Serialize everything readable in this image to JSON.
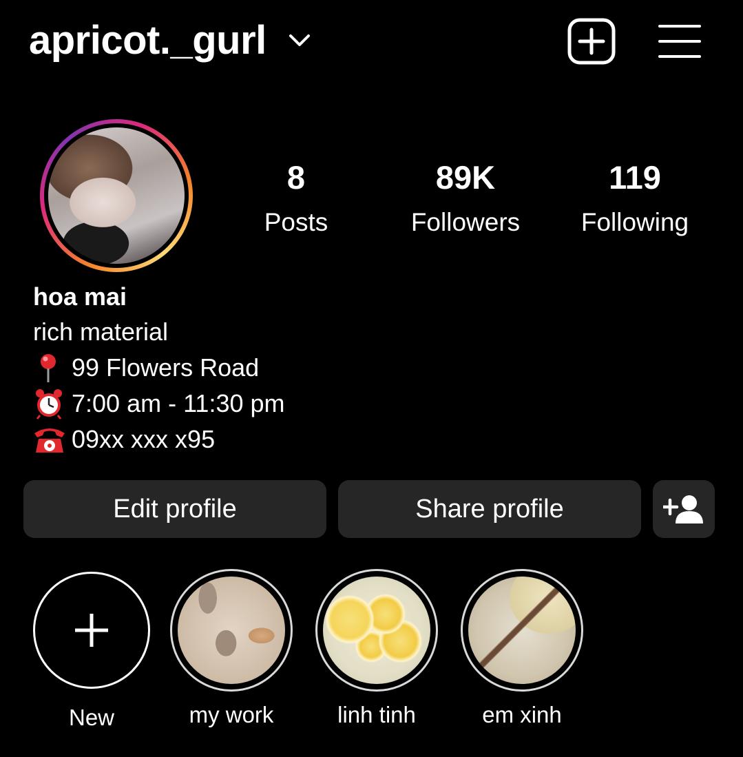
{
  "header": {
    "username": "apricot._gurl",
    "icons": {
      "account_switch": "chevron-down-icon",
      "create": "plus-square-icon",
      "menu": "hamburger-menu-icon"
    }
  },
  "profile": {
    "stats": [
      {
        "value": "8",
        "label": "Posts"
      },
      {
        "value": "89K",
        "label": "Followers"
      },
      {
        "value": "119",
        "label": "Following"
      }
    ],
    "name": "hoa mai",
    "category": "rich material",
    "address_icon": "round-pushpin-icon",
    "address": "99 Flowers Road",
    "hours_icon": "alarm-clock-icon",
    "hours": "7:00 am - 11:30 pm",
    "phone_icon": "telephone-icon",
    "phone": "09xx xxx x95"
  },
  "actions": {
    "edit_label": "Edit profile",
    "share_label": "Share profile",
    "discover_icon": "add-person-icon"
  },
  "highlights": [
    {
      "label": "New"
    },
    {
      "label": "my work"
    },
    {
      "label": "linh tinh"
    },
    {
      "label": "em xinh"
    }
  ],
  "colors": {
    "background": "#000000",
    "button": "#262626",
    "story_ring": [
      "#f58529",
      "#dd2a7b",
      "#8134af"
    ]
  }
}
